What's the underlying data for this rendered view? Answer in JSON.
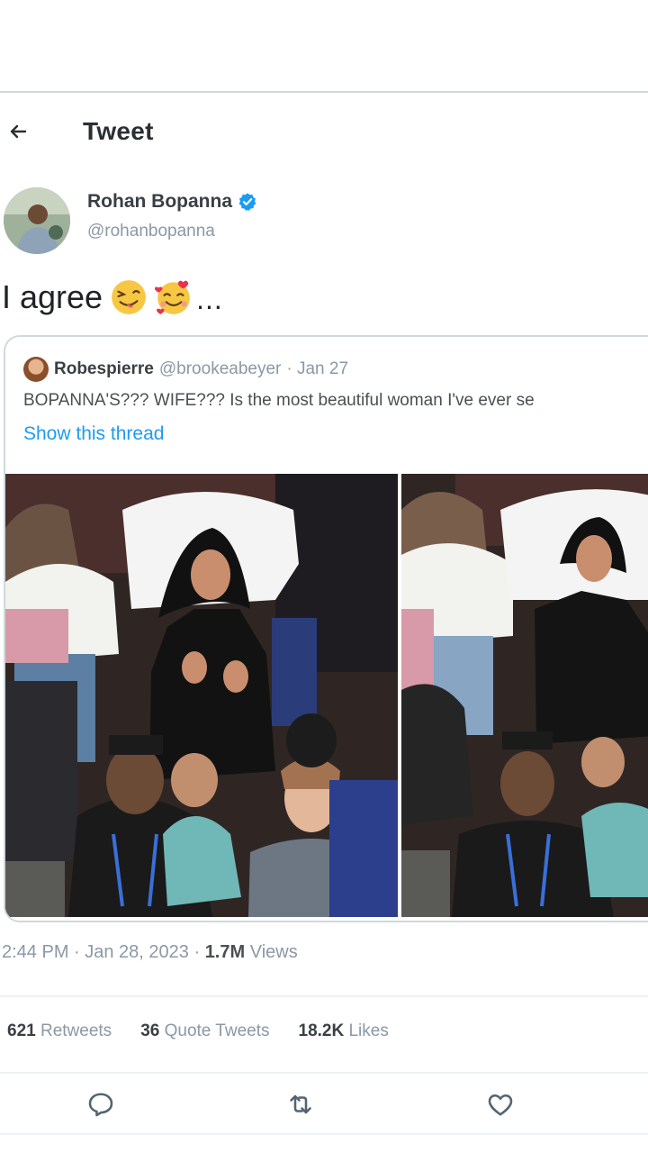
{
  "header": {
    "title": "Tweet",
    "back_icon": "back-arrow-icon"
  },
  "tweet": {
    "author": {
      "name": "Rohan Bopanna",
      "handle": "@rohanbopanna",
      "verified": true
    },
    "text": "I agree",
    "emojis": [
      "winking-face-tongue-emoji",
      "smiling-face-with-hearts-emoji"
    ],
    "text_suffix": "...",
    "timestamp": "2:44 PM · Jan 28, 2023 · ",
    "views_count": "1.7M",
    "views_label": " Views"
  },
  "quoted_tweet": {
    "name": "Robespierre",
    "handle": "@brookeabeyer",
    "date": "· Jan 27",
    "text": "BOPANNA'S??? WIFE??? Is the most beautiful woman I've ever se",
    "show_thread": "Show this thread"
  },
  "stats": {
    "retweets_count": "621",
    "retweets_label": " Retweets",
    "quotes_count": "36",
    "quotes_label": " Quote Tweets",
    "likes_count": "18.2K",
    "likes_label": " Likes"
  },
  "actions": [
    "reply-icon",
    "retweet-icon",
    "like-icon"
  ],
  "colors": {
    "link": "#1d9bf0",
    "verified": "#1d9bf0",
    "muted": "#8b98a5",
    "border": "#cfd9de"
  }
}
